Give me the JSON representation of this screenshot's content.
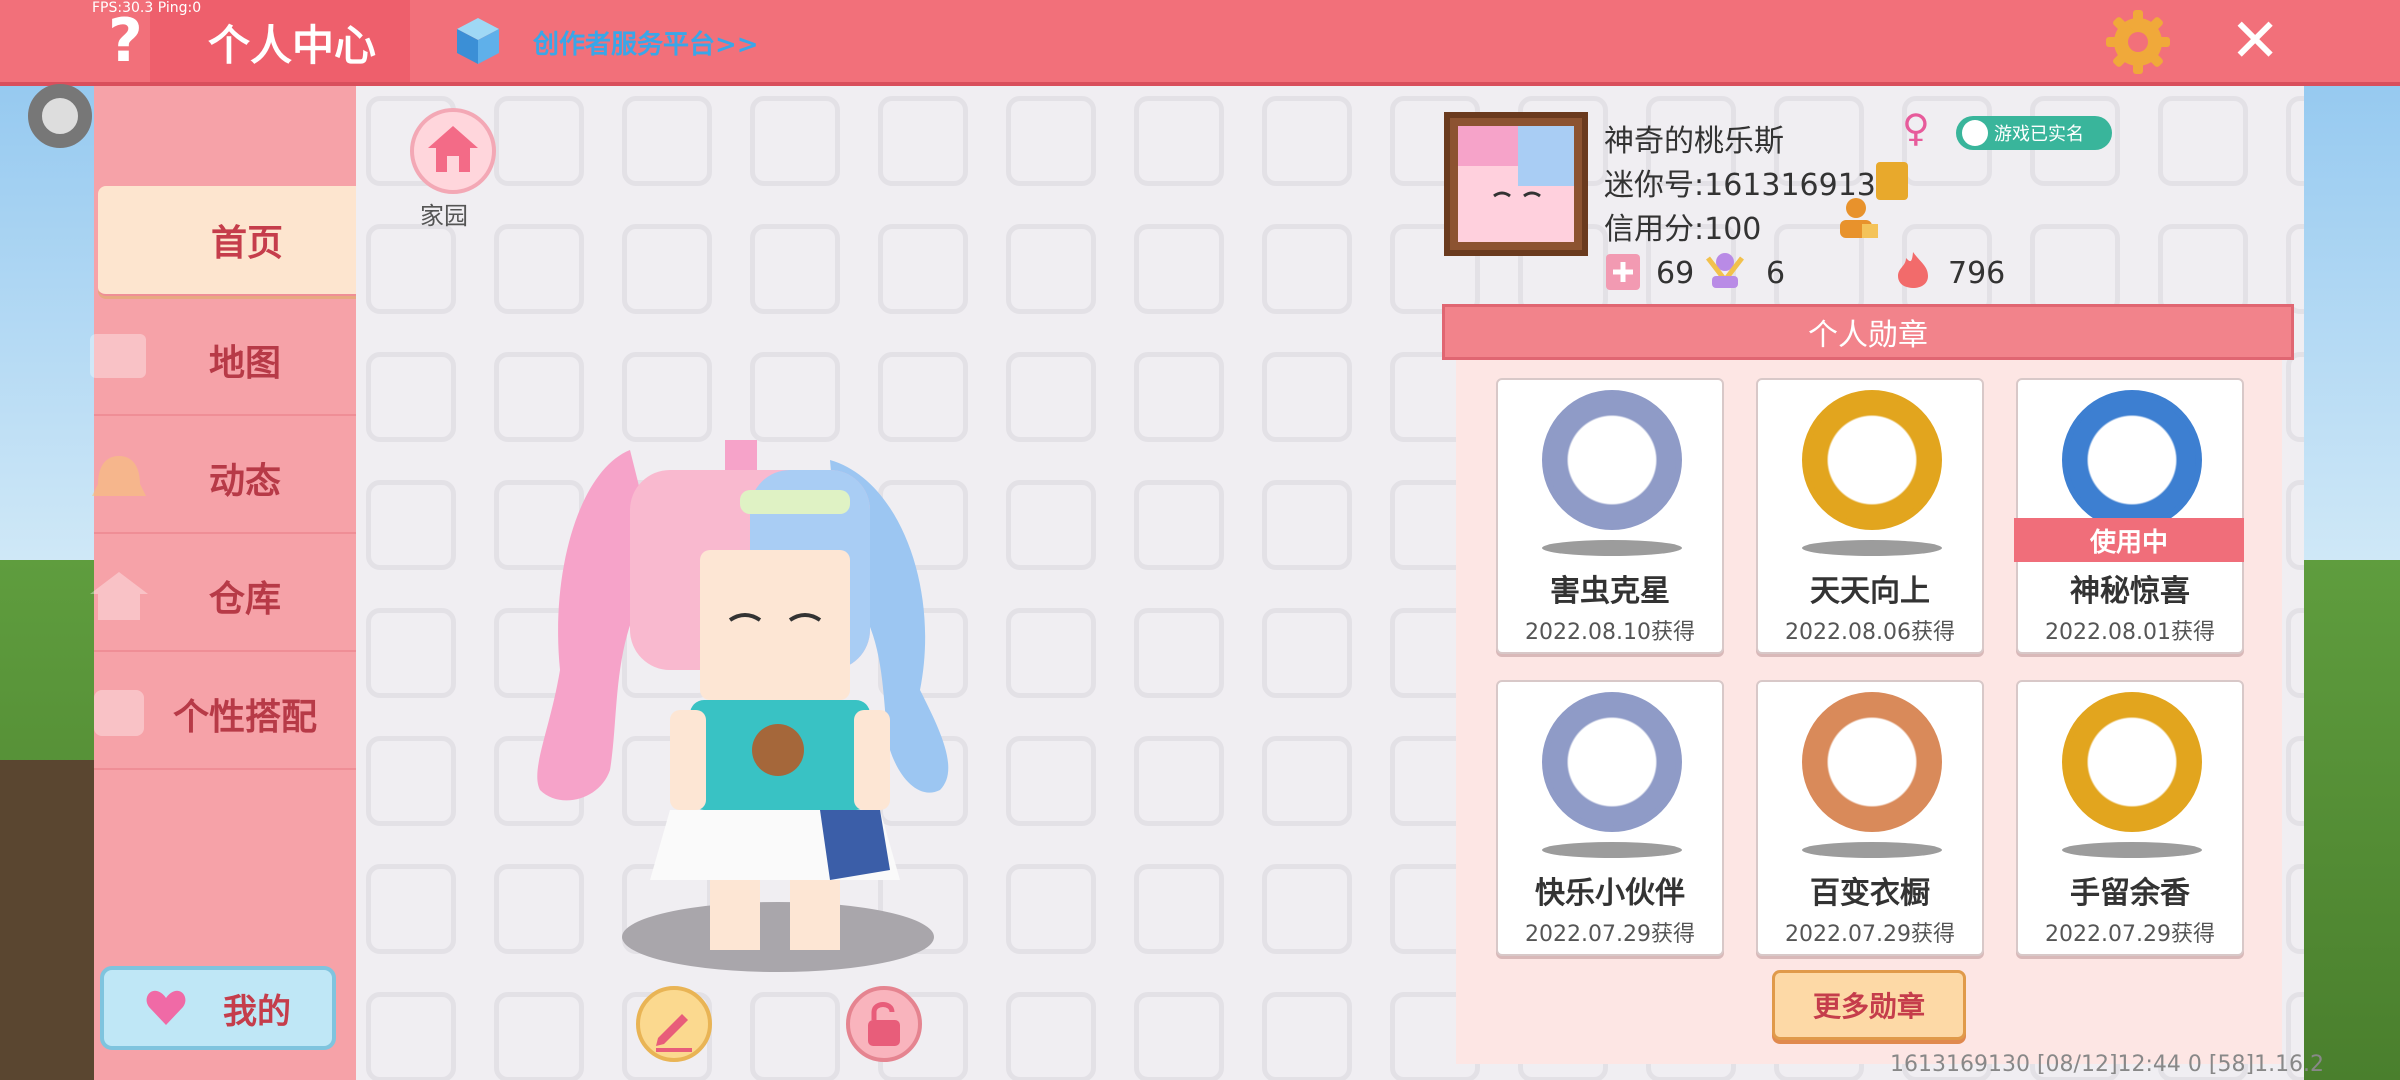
{
  "debug": {
    "fps_text": "FPS:30.3  Ping:0"
  },
  "header": {
    "title": "个人中心",
    "creator_link": "创作者服务平台>>"
  },
  "sidebar": {
    "items": [
      {
        "label": "首页",
        "active": true
      },
      {
        "label": "地图",
        "active": false
      },
      {
        "label": "动态",
        "active": false
      },
      {
        "label": "仓库",
        "active": false
      },
      {
        "label": "个性搭配",
        "active": false
      }
    ],
    "mine_label": "我的"
  },
  "home": {
    "label": "家园"
  },
  "profile": {
    "nickname": "神奇的桃乐斯",
    "mini_id": "迷你号:1613169130",
    "credit": "信用分:100",
    "verified": "游戏已实名",
    "stats": {
      "likes": "69",
      "fans": "6",
      "heat": "796"
    }
  },
  "medals": {
    "header": "个人勋章",
    "items": [
      {
        "name": "害虫克星",
        "date": "2022.08.10获得",
        "color": "#8f9bc7"
      },
      {
        "name": "天天向上",
        "date": "2022.08.06获得",
        "color": "#e2a51e"
      },
      {
        "name": "神秘惊喜",
        "date": "2022.08.01获得",
        "color": "#3d7fd1",
        "status": "使用中"
      },
      {
        "name": "快乐小伙伴",
        "date": "2022.07.29获得",
        "color": "#8f9bc7"
      },
      {
        "name": "百变衣橱",
        "date": "2022.07.29获得",
        "color": "#d98a5a"
      },
      {
        "name": "手留余香",
        "date": "2022.07.29获得",
        "color": "#e2a51e"
      }
    ],
    "more_label": "更多勋章"
  },
  "footer": {
    "info": "1613169130   [08/12]12:44 0  [58]1.16.2"
  }
}
